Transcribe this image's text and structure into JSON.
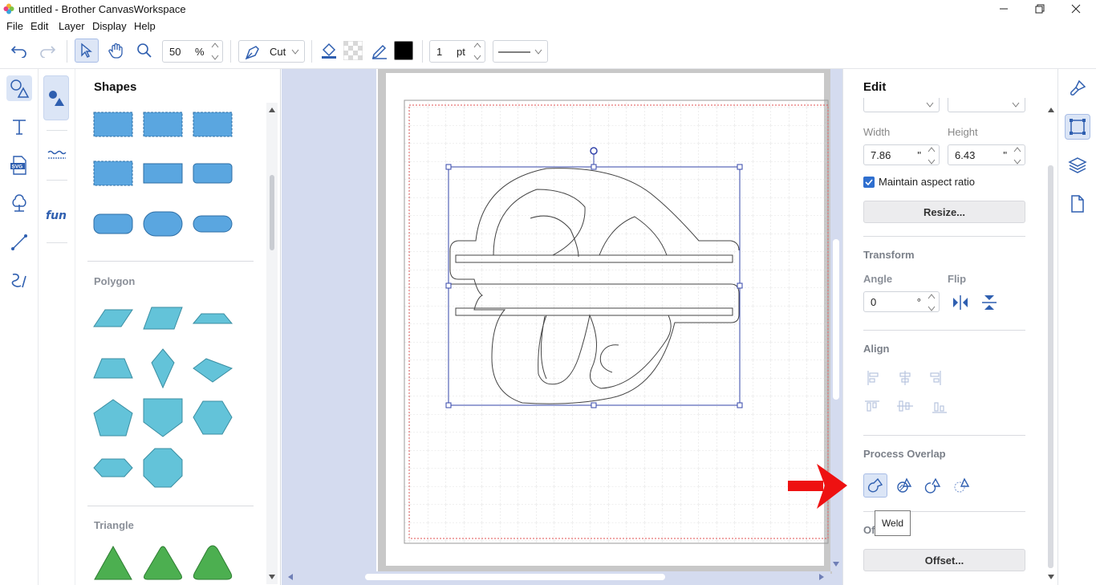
{
  "window": {
    "title": "untitled - Brother CanvasWorkspace"
  },
  "menu": {
    "file": "File",
    "edit": "Edit",
    "layer": "Layer",
    "display": "Display",
    "help": "Help"
  },
  "toolbar": {
    "zoom_value": "50",
    "zoom_unit": "%",
    "cut_mode": "Cut",
    "line_width_value": "1",
    "line_width_unit": "pt",
    "line_color": "#000000"
  },
  "shapes_panel": {
    "title": "Shapes",
    "sections": {
      "polygon": "Polygon",
      "triangle": "Triangle"
    },
    "colors": {
      "basic": "#5aa6e0",
      "polygon": "#63c3d9",
      "triangle": "#4caf50"
    }
  },
  "edit_panel": {
    "title": "Edit",
    "width_label": "Width",
    "height_label": "Height",
    "width_value": "7.86",
    "height_value": "6.43",
    "size_unit": "\"",
    "maintain_aspect_label": "Maintain aspect ratio",
    "maintain_aspect_checked": true,
    "resize_button": "Resize...",
    "transform_title": "Transform",
    "angle_label": "Angle",
    "angle_value": "0",
    "angle_unit": "°",
    "flip_label": "Flip",
    "align_title": "Align",
    "process_overlap_title": "Process Overlap",
    "offset_title_partial": "Of",
    "offset_button": "Offset...",
    "tooltip": "Weld"
  }
}
